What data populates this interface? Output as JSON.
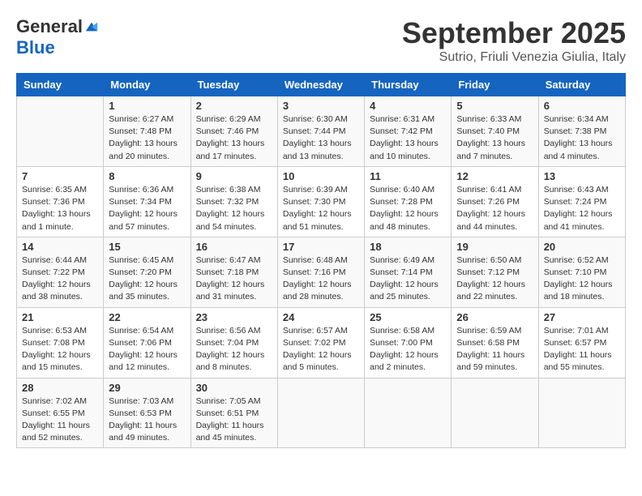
{
  "logo": {
    "general": "General",
    "blue": "Blue"
  },
  "title": "September 2025",
  "subtitle": "Sutrio, Friuli Venezia Giulia, Italy",
  "days": [
    "Sunday",
    "Monday",
    "Tuesday",
    "Wednesday",
    "Thursday",
    "Friday",
    "Saturday"
  ],
  "weeks": [
    [
      {
        "day": "",
        "sunrise": "",
        "sunset": "",
        "daylight": ""
      },
      {
        "day": "1",
        "sunrise": "Sunrise: 6:27 AM",
        "sunset": "Sunset: 7:48 PM",
        "daylight": "Daylight: 13 hours and 20 minutes."
      },
      {
        "day": "2",
        "sunrise": "Sunrise: 6:29 AM",
        "sunset": "Sunset: 7:46 PM",
        "daylight": "Daylight: 13 hours and 17 minutes."
      },
      {
        "day": "3",
        "sunrise": "Sunrise: 6:30 AM",
        "sunset": "Sunset: 7:44 PM",
        "daylight": "Daylight: 13 hours and 13 minutes."
      },
      {
        "day": "4",
        "sunrise": "Sunrise: 6:31 AM",
        "sunset": "Sunset: 7:42 PM",
        "daylight": "Daylight: 13 hours and 10 minutes."
      },
      {
        "day": "5",
        "sunrise": "Sunrise: 6:33 AM",
        "sunset": "Sunset: 7:40 PM",
        "daylight": "Daylight: 13 hours and 7 minutes."
      },
      {
        "day": "6",
        "sunrise": "Sunrise: 6:34 AM",
        "sunset": "Sunset: 7:38 PM",
        "daylight": "Daylight: 13 hours and 4 minutes."
      }
    ],
    [
      {
        "day": "7",
        "sunrise": "Sunrise: 6:35 AM",
        "sunset": "Sunset: 7:36 PM",
        "daylight": "Daylight: 13 hours and 1 minute."
      },
      {
        "day": "8",
        "sunrise": "Sunrise: 6:36 AM",
        "sunset": "Sunset: 7:34 PM",
        "daylight": "Daylight: 12 hours and 57 minutes."
      },
      {
        "day": "9",
        "sunrise": "Sunrise: 6:38 AM",
        "sunset": "Sunset: 7:32 PM",
        "daylight": "Daylight: 12 hours and 54 minutes."
      },
      {
        "day": "10",
        "sunrise": "Sunrise: 6:39 AM",
        "sunset": "Sunset: 7:30 PM",
        "daylight": "Daylight: 12 hours and 51 minutes."
      },
      {
        "day": "11",
        "sunrise": "Sunrise: 6:40 AM",
        "sunset": "Sunset: 7:28 PM",
        "daylight": "Daylight: 12 hours and 48 minutes."
      },
      {
        "day": "12",
        "sunrise": "Sunrise: 6:41 AM",
        "sunset": "Sunset: 7:26 PM",
        "daylight": "Daylight: 12 hours and 44 minutes."
      },
      {
        "day": "13",
        "sunrise": "Sunrise: 6:43 AM",
        "sunset": "Sunset: 7:24 PM",
        "daylight": "Daylight: 12 hours and 41 minutes."
      }
    ],
    [
      {
        "day": "14",
        "sunrise": "Sunrise: 6:44 AM",
        "sunset": "Sunset: 7:22 PM",
        "daylight": "Daylight: 12 hours and 38 minutes."
      },
      {
        "day": "15",
        "sunrise": "Sunrise: 6:45 AM",
        "sunset": "Sunset: 7:20 PM",
        "daylight": "Daylight: 12 hours and 35 minutes."
      },
      {
        "day": "16",
        "sunrise": "Sunrise: 6:47 AM",
        "sunset": "Sunset: 7:18 PM",
        "daylight": "Daylight: 12 hours and 31 minutes."
      },
      {
        "day": "17",
        "sunrise": "Sunrise: 6:48 AM",
        "sunset": "Sunset: 7:16 PM",
        "daylight": "Daylight: 12 hours and 28 minutes."
      },
      {
        "day": "18",
        "sunrise": "Sunrise: 6:49 AM",
        "sunset": "Sunset: 7:14 PM",
        "daylight": "Daylight: 12 hours and 25 minutes."
      },
      {
        "day": "19",
        "sunrise": "Sunrise: 6:50 AM",
        "sunset": "Sunset: 7:12 PM",
        "daylight": "Daylight: 12 hours and 22 minutes."
      },
      {
        "day": "20",
        "sunrise": "Sunrise: 6:52 AM",
        "sunset": "Sunset: 7:10 PM",
        "daylight": "Daylight: 12 hours and 18 minutes."
      }
    ],
    [
      {
        "day": "21",
        "sunrise": "Sunrise: 6:53 AM",
        "sunset": "Sunset: 7:08 PM",
        "daylight": "Daylight: 12 hours and 15 minutes."
      },
      {
        "day": "22",
        "sunrise": "Sunrise: 6:54 AM",
        "sunset": "Sunset: 7:06 PM",
        "daylight": "Daylight: 12 hours and 12 minutes."
      },
      {
        "day": "23",
        "sunrise": "Sunrise: 6:56 AM",
        "sunset": "Sunset: 7:04 PM",
        "daylight": "Daylight: 12 hours and 8 minutes."
      },
      {
        "day": "24",
        "sunrise": "Sunrise: 6:57 AM",
        "sunset": "Sunset: 7:02 PM",
        "daylight": "Daylight: 12 hours and 5 minutes."
      },
      {
        "day": "25",
        "sunrise": "Sunrise: 6:58 AM",
        "sunset": "Sunset: 7:00 PM",
        "daylight": "Daylight: 12 hours and 2 minutes."
      },
      {
        "day": "26",
        "sunrise": "Sunrise: 6:59 AM",
        "sunset": "Sunset: 6:58 PM",
        "daylight": "Daylight: 11 hours and 59 minutes."
      },
      {
        "day": "27",
        "sunrise": "Sunrise: 7:01 AM",
        "sunset": "Sunset: 6:57 PM",
        "daylight": "Daylight: 11 hours and 55 minutes."
      }
    ],
    [
      {
        "day": "28",
        "sunrise": "Sunrise: 7:02 AM",
        "sunset": "Sunset: 6:55 PM",
        "daylight": "Daylight: 11 hours and 52 minutes."
      },
      {
        "day": "29",
        "sunrise": "Sunrise: 7:03 AM",
        "sunset": "Sunset: 6:53 PM",
        "daylight": "Daylight: 11 hours and 49 minutes."
      },
      {
        "day": "30",
        "sunrise": "Sunrise: 7:05 AM",
        "sunset": "Sunset: 6:51 PM",
        "daylight": "Daylight: 11 hours and 45 minutes."
      },
      {
        "day": "",
        "sunrise": "",
        "sunset": "",
        "daylight": ""
      },
      {
        "day": "",
        "sunrise": "",
        "sunset": "",
        "daylight": ""
      },
      {
        "day": "",
        "sunrise": "",
        "sunset": "",
        "daylight": ""
      },
      {
        "day": "",
        "sunrise": "",
        "sunset": "",
        "daylight": ""
      }
    ]
  ]
}
